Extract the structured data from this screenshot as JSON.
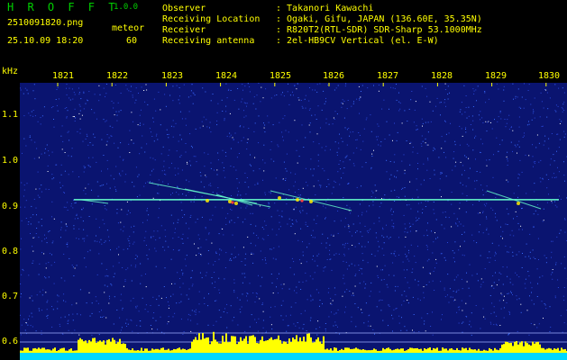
{
  "header": {
    "app_name": "H R O F F T",
    "app_version": "1.0.0",
    "filename": "2510091820.png",
    "datetime": "25.10.09 18:20",
    "meteor_label": "meteor",
    "meteor_count": "60"
  },
  "info": [
    {
      "label": "Observer",
      "value": ": Takanori Kawachi"
    },
    {
      "label": "Receiving Location",
      "value": ": Ogaki, Gifu, JAPAN (136.60E, 35.35N)"
    },
    {
      "label": "Receiver",
      "value": ": R820T2(RTL-SDR) SDR-Sharp 53.1000MHz"
    },
    {
      "label": "Receiving antenna",
      "value": ": 2el-HB9CV Vertical (el. E-W)"
    }
  ],
  "chart_data": {
    "type": "heatmap",
    "ylabel": "kHz",
    "x_ticks": [
      "1821",
      "1822",
      "1823",
      "1824",
      "1825",
      "1826",
      "1827",
      "1828",
      "1829",
      "1830"
    ],
    "y_ticks": [
      "1.1",
      "1.0",
      "0.9",
      "0.8",
      "0.7",
      "0.6"
    ],
    "carrier_khz": 0.915,
    "colors": {
      "background": "#0a1470",
      "noise": "#3a6cff",
      "carrier": "#66ffcc",
      "echo": "#ffea00",
      "histogram": "#ffff00",
      "baseline": "#00d8ff"
    }
  }
}
